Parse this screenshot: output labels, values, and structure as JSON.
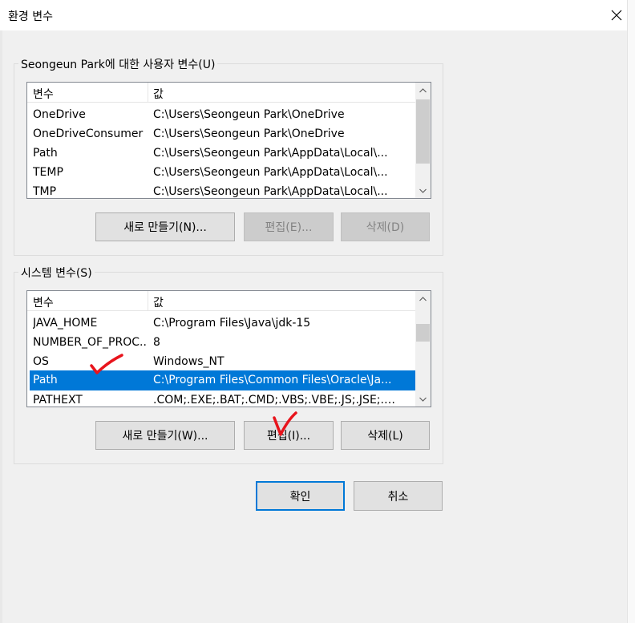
{
  "window": {
    "title": "환경 변수",
    "close_icon": "close-icon"
  },
  "user_vars": {
    "group_label": "Seongeun Park에 대한 사용자 변수(U)",
    "columns": [
      "변수",
      "값"
    ],
    "rows": [
      {
        "name": "OneDrive",
        "value": "C:\\Users\\Seongeun Park\\OneDrive"
      },
      {
        "name": "OneDriveConsumer",
        "value": "C:\\Users\\Seongeun Park\\OneDrive"
      },
      {
        "name": "Path",
        "value": "C:\\Users\\Seongeun Park\\AppData\\Local\\..."
      },
      {
        "name": "TEMP",
        "value": "C:\\Users\\Seongeun Park\\AppData\\Local\\..."
      },
      {
        "name": "TMP",
        "value": "C:\\Users\\Seongeun Park\\AppData\\Local\\..."
      }
    ],
    "buttons": {
      "new": "새로 만들기(N)...",
      "edit": "편집(E)...",
      "delete": "삭제(D)"
    }
  },
  "system_vars": {
    "group_label": "시스템 변수(S)",
    "columns": [
      "변수",
      "값"
    ],
    "rows": [
      {
        "name": "JAVA_HOME",
        "value": "C:\\Program Files\\Java\\jdk-15"
      },
      {
        "name": "NUMBER_OF_PROC...",
        "value": "8"
      },
      {
        "name": "OS",
        "value": "Windows_NT"
      },
      {
        "name": "Path",
        "value": "C:\\Program Files\\Common Files\\Oracle\\Ja..."
      },
      {
        "name": "PATHEXT",
        "value": ".COM;.EXE;.BAT;.CMD;.VBS;.VBE;.JS;.JSE;.WSF;..."
      }
    ],
    "selected_row": "Path",
    "buttons": {
      "new": "새로 만들기(W)...",
      "edit": "편집(I)...",
      "delete": "삭제(L)"
    }
  },
  "footer": {
    "ok": "확인",
    "cancel": "취소"
  },
  "colors": {
    "selection": "#0078d7",
    "annotation": "#e8141c"
  }
}
